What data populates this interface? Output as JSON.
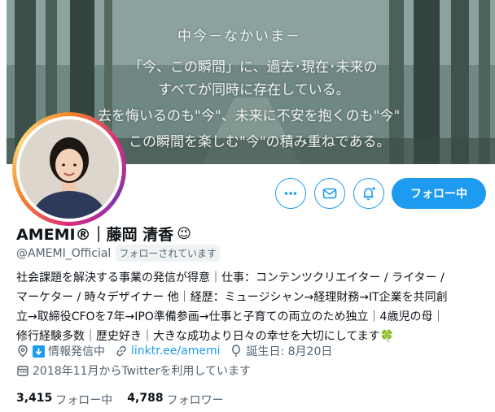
{
  "banner": {
    "lines": [
      "中今－なかいま－",
      "「今、この瞬間」に、過去･現在･未来の",
      "すべてが同時に存在している。",
      "去を悔いるのも\"今\"、未来に不安を抱くのも\"今\"",
      "この瞬間を楽しむ\"今\"の積み重ねである。"
    ]
  },
  "profile": {
    "name": "AMEMI®｜藤岡 清香",
    "name_emoji": "😉",
    "handle": "@AMEMI_Official",
    "follows_you": "フォローされています"
  },
  "actions": {
    "follow_label": "フォロー中"
  },
  "bio": {
    "lines": [
      "社会課題を解決する事業の発信が得意｜仕事：コンテンツクリエイター / ライター /",
      "マーケター / 時々デザイナー 他｜経歴：ミュージシャン→経理財務→IT企業を共同創",
      "立→取締役CFOを7年→IPO準備参画→仕事と子育ての両立のため独立｜4歳児の母｜",
      "修行経験多数｜歴史好き｜大きな成功より日々の幸せを大切にしてます"
    ],
    "end_emoji": "🍀"
  },
  "meta": {
    "location": "情報発信中",
    "link": "linktr.ee/amemi",
    "birthday": "誕生日: 8月20日",
    "joined": "2018年11月からTwitterを利用しています"
  },
  "stats": {
    "following_count": "3,415",
    "following_label": "フォロー中",
    "followers_count": "4,788",
    "followers_label": "フォロワー"
  },
  "colors": {
    "accent": "#1d9bf0",
    "text": "#0f1419",
    "muted": "#536471",
    "follows_badge_bg": "#eff3f4"
  }
}
